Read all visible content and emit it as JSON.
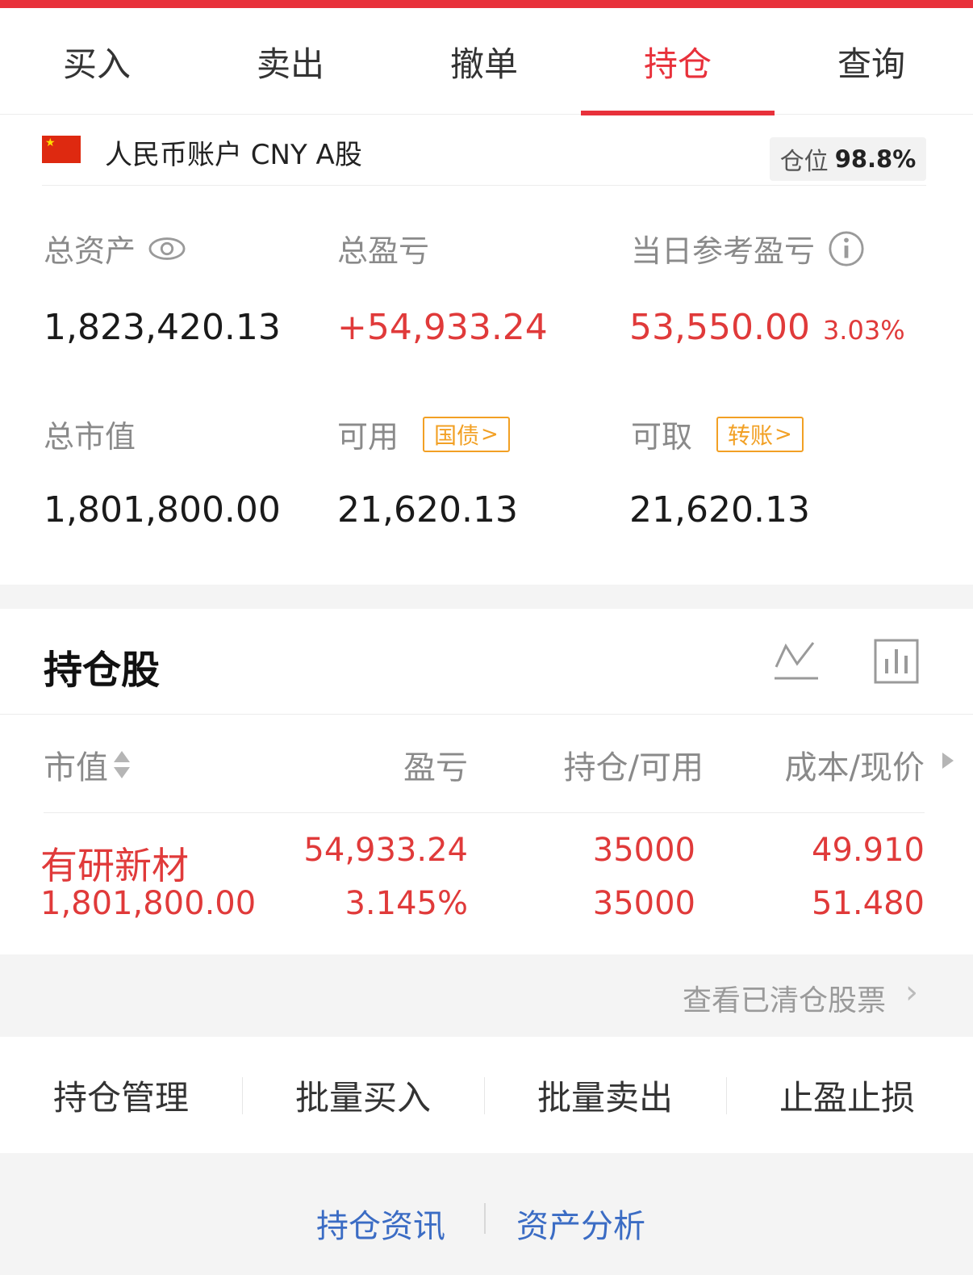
{
  "tabs": [
    "买入",
    "卖出",
    "撤单",
    "持仓",
    "查询"
  ],
  "active_tab": "持仓",
  "account": {
    "name": "人民币账户 CNY A股",
    "position_label": "仓位",
    "position_value": "98.8%"
  },
  "summary": {
    "total_assets_label": "总资产",
    "total_assets": "1,823,420.13",
    "total_pnl_label": "总盈亏",
    "total_pnl": "+54,933.24",
    "today_pnl_label": "当日参考盈亏",
    "today_pnl": "53,550.00",
    "today_pnl_pct": "3.03%",
    "market_value_label": "总市值",
    "market_value": "1,801,800.00",
    "available_label": "可用",
    "available_badge": "国债",
    "available": "21,620.13",
    "withdrawable_label": "可取",
    "withdrawable_badge": "转账",
    "withdrawable": "21,620.13"
  },
  "holdings": {
    "title": "持仓股",
    "columns": [
      "市值",
      "盈亏",
      "持仓/可用",
      "成本/现价"
    ],
    "rows": [
      {
        "name": "有研新材",
        "market_value": "1,801,800.00",
        "pnl": "54,933.24",
        "pnl_pct": "3.145%",
        "position": "35000",
        "available": "35000",
        "cost": "49.910",
        "price": "51.480"
      }
    ],
    "cleared_link": "查看已清仓股票"
  },
  "actions": [
    "持仓管理",
    "批量买入",
    "批量卖出",
    "止盈止损"
  ],
  "footer_links": [
    "持仓资讯",
    "资产分析"
  ],
  "colors": {
    "accent_red": "#e8313b",
    "profit_red": "#e03a3a",
    "badge_orange": "#f2a024",
    "link_blue": "#3b6cc4"
  }
}
